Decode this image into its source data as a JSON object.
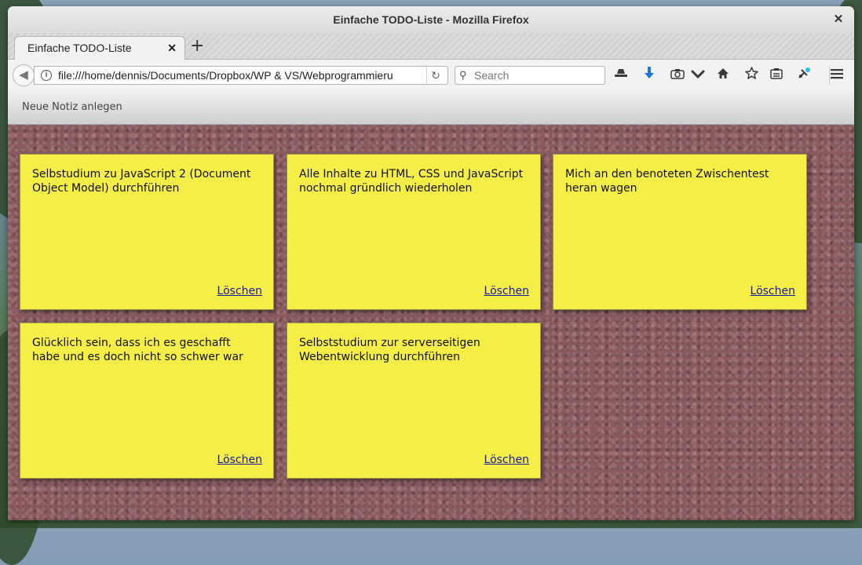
{
  "window": {
    "title": "Einfache TODO-Liste - Mozilla Firefox",
    "close_glyph": "✕"
  },
  "tabs": [
    {
      "label": "Einfache TODO-Liste",
      "close_glyph": "✕"
    }
  ],
  "new_tab_glyph": "+",
  "nav": {
    "url": "file:///home/dennis/Documents/Dropbox/WP & VS/Webprogrammieru",
    "search_placeholder": "Search"
  },
  "toolbar_icons": [
    "incognito-icon",
    "download-icon",
    "screenshot-icon",
    "pocket-icon",
    "home-icon",
    "bookmark-star-icon",
    "reader-icon",
    "extension-icon",
    "menu-icon"
  ],
  "app": {
    "new_note_label": "Neue Notiz anlegen",
    "background_color": "#8a5a5f",
    "note_color": "#f5ee47",
    "notes": [
      {
        "text": "Selbstudium zu JavaScript 2 (Document Object Model) durchführen",
        "delete_label": "Löschen"
      },
      {
        "text": "Alle Inhalte zu HTML, CSS und JavaScript nochmal gründlich wiederholen",
        "delete_label": "Löschen"
      },
      {
        "text": "Mich an den benoteten Zwischentest heran wagen",
        "delete_label": "Löschen"
      },
      {
        "text": "Glücklich sein, dass ich es geschafft habe und es doch nicht so schwer war",
        "delete_label": "Löschen"
      },
      {
        "text": "Selbststudium zur serverseitigen Webentwicklung durchführen",
        "delete_label": "Löschen"
      }
    ]
  }
}
